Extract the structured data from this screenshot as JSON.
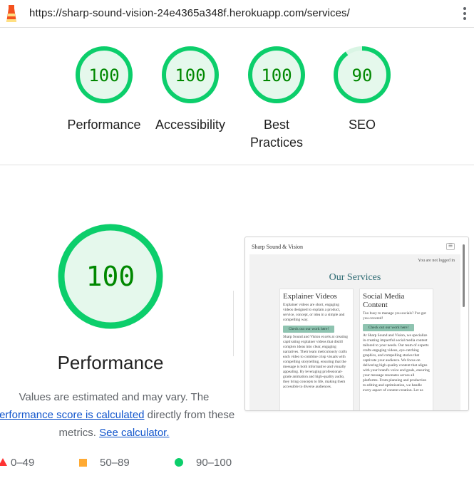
{
  "browser": {
    "url": "https://sharp-sound-vision-24e4365a348f.herokuapp.com/services/",
    "logo_icon": "lighthouse-icon",
    "menu_icon": "kebab-menu-icon"
  },
  "colors": {
    "pass": "#0cce6b",
    "pass_text": "#008800",
    "pass_fill": "#e5f8ec",
    "average": "#ffaa33",
    "fail": "#ff3333"
  },
  "scores": [
    {
      "score": 100,
      "label": "Performance"
    },
    {
      "score": 100,
      "label": "Accessibility"
    },
    {
      "score": 100,
      "label": "Best Practices"
    },
    {
      "score": 90,
      "label": "SEO"
    }
  ],
  "main": {
    "score": 100,
    "title": "Performance",
    "desc_before": "Values are estimated and may vary. The ",
    "desc_link1": "performance score is calculated",
    "desc_middle": " directly from these metrics. ",
    "desc_link2": "See calculator."
  },
  "legend": {
    "fail": "0–49",
    "average": "50–89",
    "pass": "90–100"
  },
  "screenshot": {
    "brand": "Sharp Sound & Vision",
    "menu_glyph": "☰",
    "login_status": "You are not logged in",
    "page_title": "Our Services",
    "cards": [
      {
        "title": "Explainer Videos",
        "intro": "Explainer videos are short, engaging videos designed to explain a product, service, concept, or idea in a simple and compelling way.",
        "button": "Check out our work here!",
        "body": "Sharp Sound and Vision excels at creating captivating explainer videos that distill complex ideas into clear, engaging narratives. Their team meticulously crafts each video to combine crisp visuals with compelling storytelling, ensuring that the message is both informative and visually appealing. By leveraging professional-grade animation and high-quality audio, they bring concepts to life, making them accessible to diverse audiences."
      },
      {
        "title": "Social Media Content",
        "intro": "Too busy to manage you socials? I've got you covered!",
        "button": "Check out our work here!",
        "body": "At Sharp Sound and Vision, we specialize in creating impactful social media content tailored to your needs. Our team of experts crafts engaging videos, eye-catching graphics, and compelling stories that captivate your audience. We focus on delivering high-quality content that aligns with your brand's voice and goals, ensuring your message resonates across all platforms. From planning and production to editing and optimization, we handle every aspect of content creation. Let us"
      }
    ]
  }
}
